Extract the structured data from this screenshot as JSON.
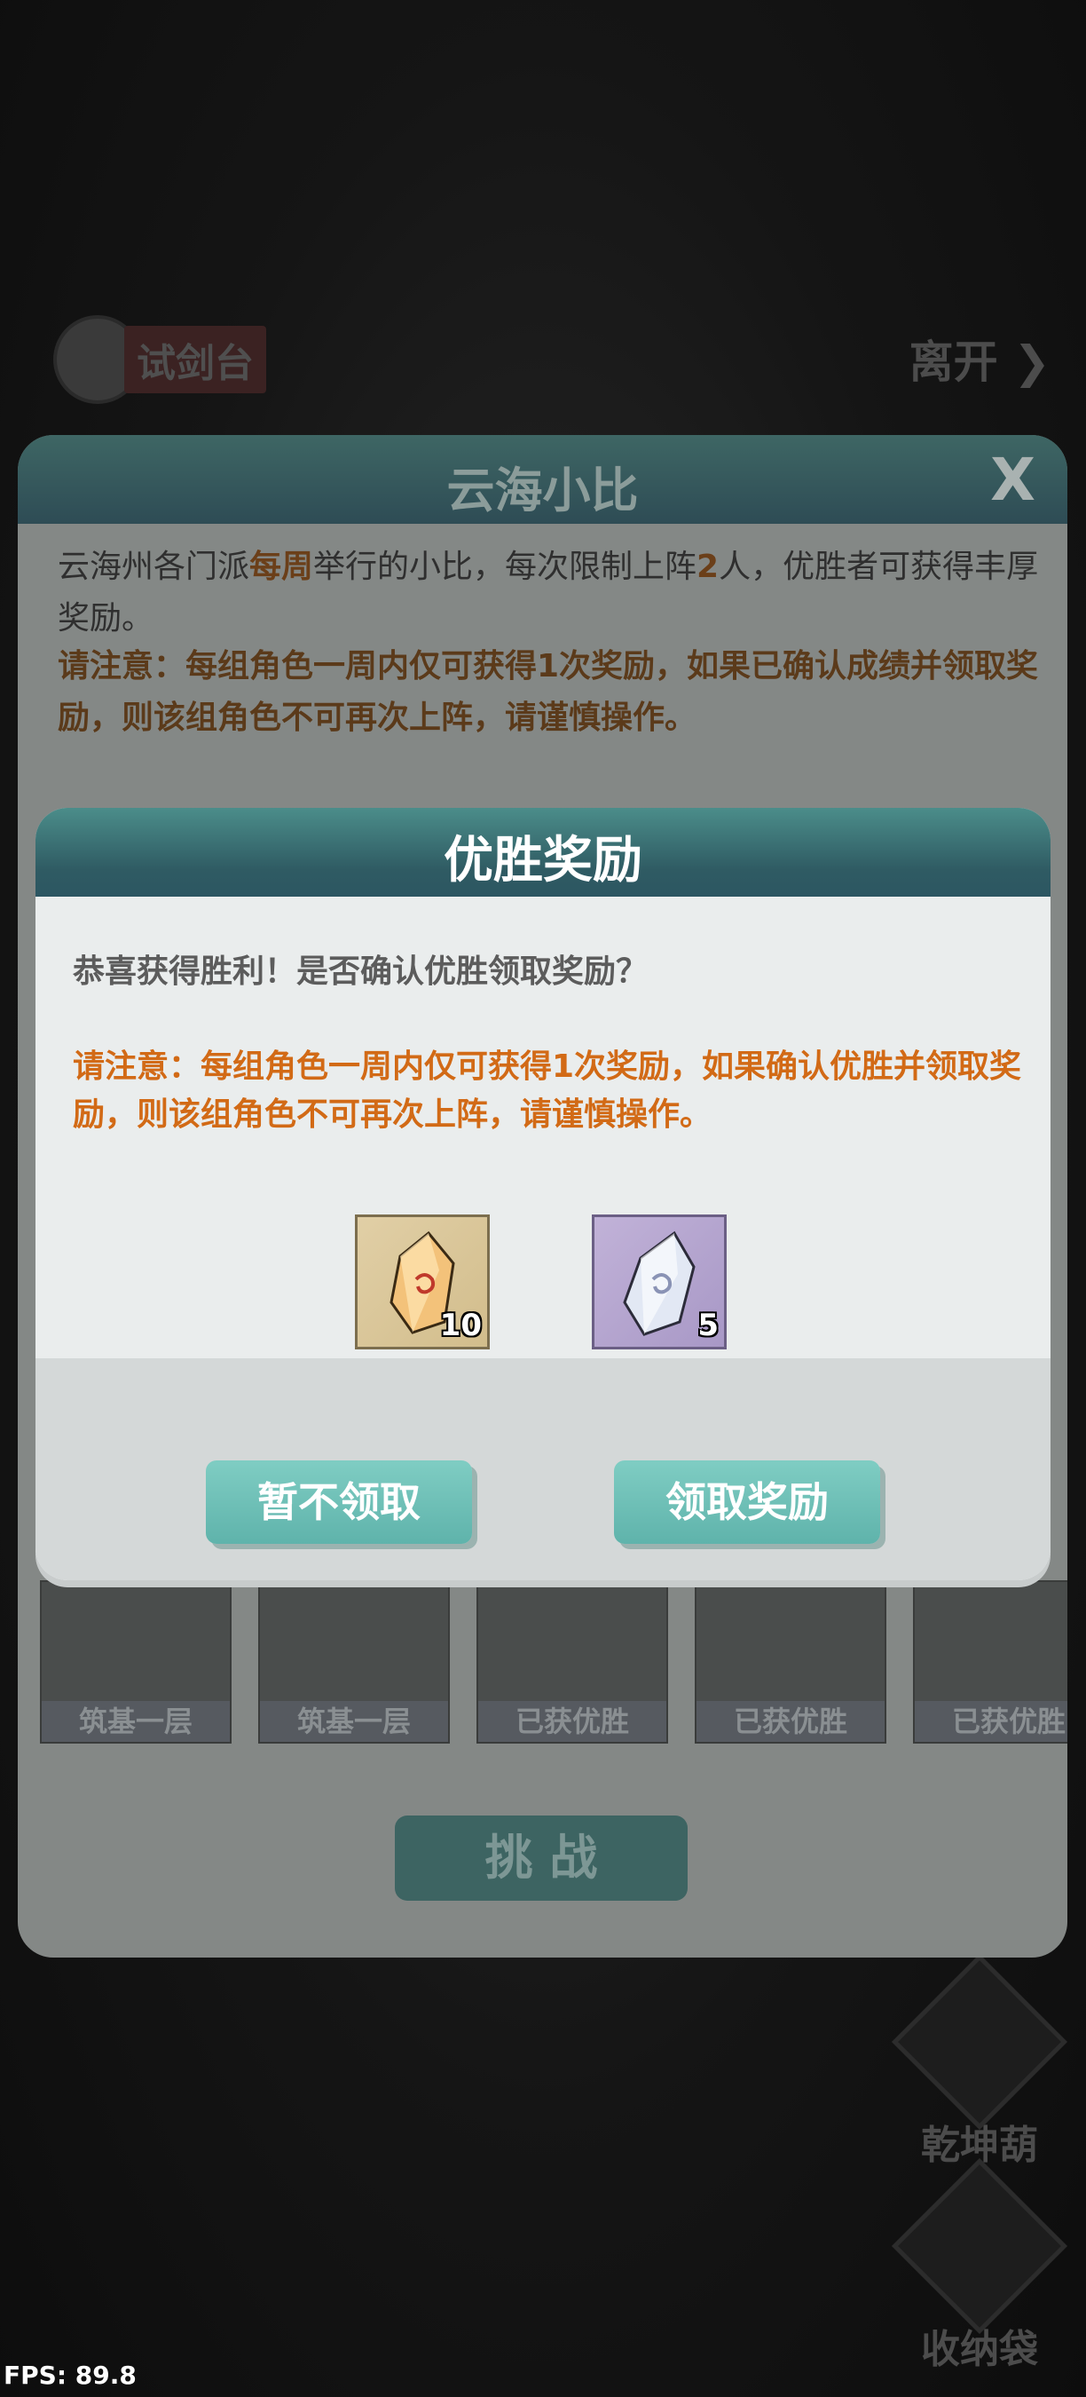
{
  "top_bar": {
    "title": "试剑台",
    "leave_label": "离开"
  },
  "side_buttons": {
    "gourd": "乾坤葫",
    "bag": "收纳袋"
  },
  "fps": "FPS: 89.8",
  "main_panel": {
    "title": "云海小比",
    "desc_part1": "云海州各门派",
    "desc_highlight1": "每周",
    "desc_part2": "举行的小比，每次限制上阵",
    "desc_highlight2": "2",
    "desc_part3": "人，优胜者可获得丰厚奖励。",
    "warning": "请注意：每组角色一周内仅可获得1次奖励，如果已确认成绩并领取奖励，则该组角色不可再次上阵，请谨慎操作。",
    "characters": [
      {
        "label": "筑基一层"
      },
      {
        "label": "筑基一层"
      },
      {
        "label": "已获优胜"
      },
      {
        "label": "已获优胜"
      },
      {
        "label": "已获优胜"
      }
    ],
    "challenge_label": "挑 战"
  },
  "dialog": {
    "title": "优胜奖励",
    "message": "恭喜获得胜利！是否确认优胜领取奖励？",
    "warning": "请注意：每组角色一周内仅可获得1次奖励，如果确认优胜并领取奖励，则该组角色不可再次上阵，请谨慎操作。",
    "rewards": [
      {
        "icon": "amber-crystal-icon",
        "count": "10"
      },
      {
        "icon": "silver-crystal-icon",
        "count": "5"
      }
    ],
    "decline_label": "暂不领取",
    "claim_label": "领取奖励"
  }
}
